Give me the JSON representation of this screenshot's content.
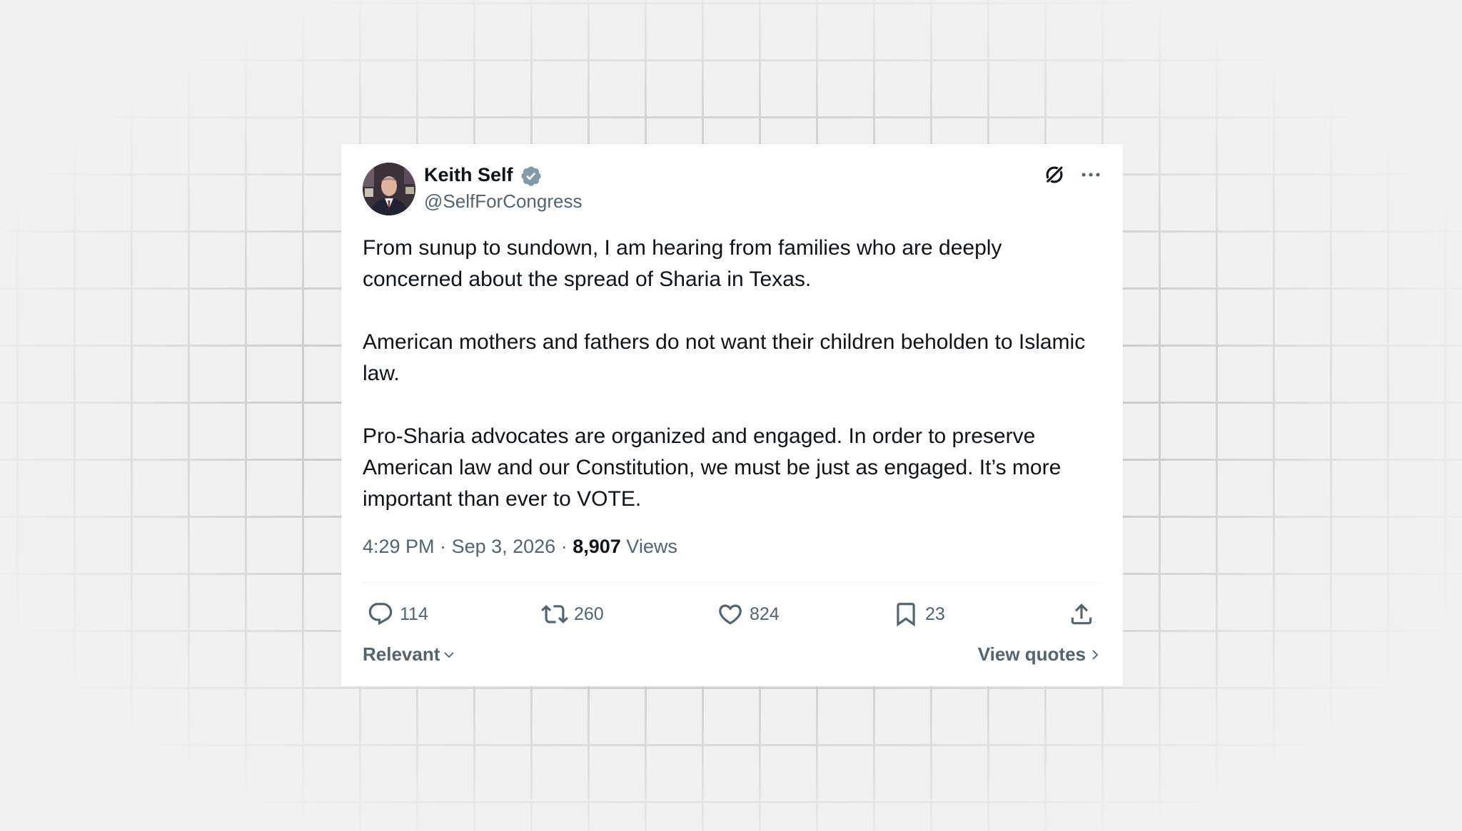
{
  "tweet": {
    "author": {
      "display_name": "Keith Self",
      "handle": "@SelfForCongress",
      "verified": true
    },
    "paragraphs": [
      "From sunup to sundown, I am hearing from families who are deeply concerned about the spread of Sharia in Texas.",
      "American mothers and fathers do not want their children beholden to Islamic law.",
      "Pro-Sharia advocates are organized and engaged. In order to preserve American law and our Constitution, we must be just as engaged. It’s more important than ever to VOTE."
    ],
    "meta": {
      "time": "4:29 PM",
      "separator": " · ",
      "date": "Sep 3, 2026",
      "views_count": "8,907",
      "views_label": "Views"
    },
    "actions": {
      "replies": "114",
      "reposts": "260",
      "likes": "824",
      "bookmarks": "23"
    },
    "footer": {
      "sort_label": "Relevant",
      "quotes_label": "View quotes"
    }
  },
  "icons": {
    "header": [
      "grok-icon",
      "more-options-icon"
    ],
    "actions": [
      "reply-icon",
      "repost-icon",
      "like-icon",
      "bookmark-icon",
      "share-icon"
    ],
    "verified": "verified-badge-icon"
  },
  "colors": {
    "primary_text": "#0f1419",
    "secondary_text": "#536471",
    "verified_badge": "#829aab",
    "card_background": "#ffffff",
    "page_background": "#f1f1f1",
    "grid_lines": "#c8c8c8"
  }
}
